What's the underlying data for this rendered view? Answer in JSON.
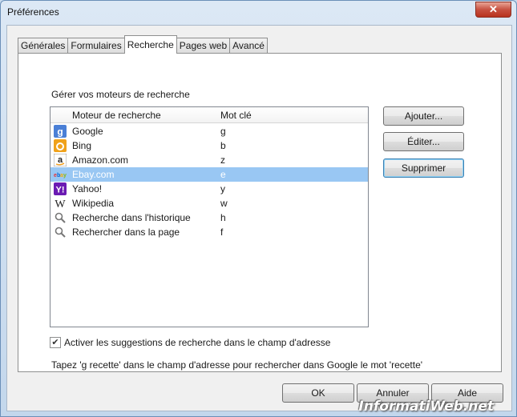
{
  "window": {
    "title": "Préférences",
    "close_glyph": "✕"
  },
  "tabs": [
    {
      "label": "Générales"
    },
    {
      "label": "Formulaires"
    },
    {
      "label": "Recherche",
      "active": true
    },
    {
      "label": "Pages web"
    },
    {
      "label": "Avancé"
    }
  ],
  "search": {
    "section_title": "Gérer vos moteurs de recherche",
    "columns": {
      "engine": "Moteur de recherche",
      "keyword": "Mot clé"
    },
    "engines": [
      {
        "name": "Google",
        "keyword": "g",
        "icon": "google-icon"
      },
      {
        "name": "Bing",
        "keyword": "b",
        "icon": "bing-icon"
      },
      {
        "name": "Amazon.com",
        "keyword": "z",
        "icon": "amazon-icon"
      },
      {
        "name": "Ebay.com",
        "keyword": "e",
        "icon": "ebay-icon",
        "selected": true
      },
      {
        "name": "Yahoo!",
        "keyword": "y",
        "icon": "yahoo-icon"
      },
      {
        "name": "Wikipedia",
        "keyword": "w",
        "icon": "wikipedia-icon"
      },
      {
        "name": "Recherche dans l'historique",
        "keyword": "h",
        "icon": "magnifier-icon"
      },
      {
        "name": "Rechercher dans la page",
        "keyword": "f",
        "icon": "magnifier-icon"
      }
    ],
    "buttons": {
      "add": "Ajouter...",
      "edit": "Éditer...",
      "delete": "Supprimer"
    },
    "suggestions_checkbox": {
      "label": "Activer les suggestions de recherche dans le champ d'adresse",
      "checked": true,
      "glyph": "✔"
    },
    "hint": "Tapez 'g recette' dans le champ d'adresse pour rechercher dans Google le mot 'recette'"
  },
  "footer": {
    "ok": "OK",
    "cancel": "Annuler",
    "help": "Aide"
  },
  "watermark": "InformatiWeb.net",
  "colors": {
    "selection": "#99c7f3",
    "title_bar": "#c9dbee",
    "close": "#c75141"
  }
}
